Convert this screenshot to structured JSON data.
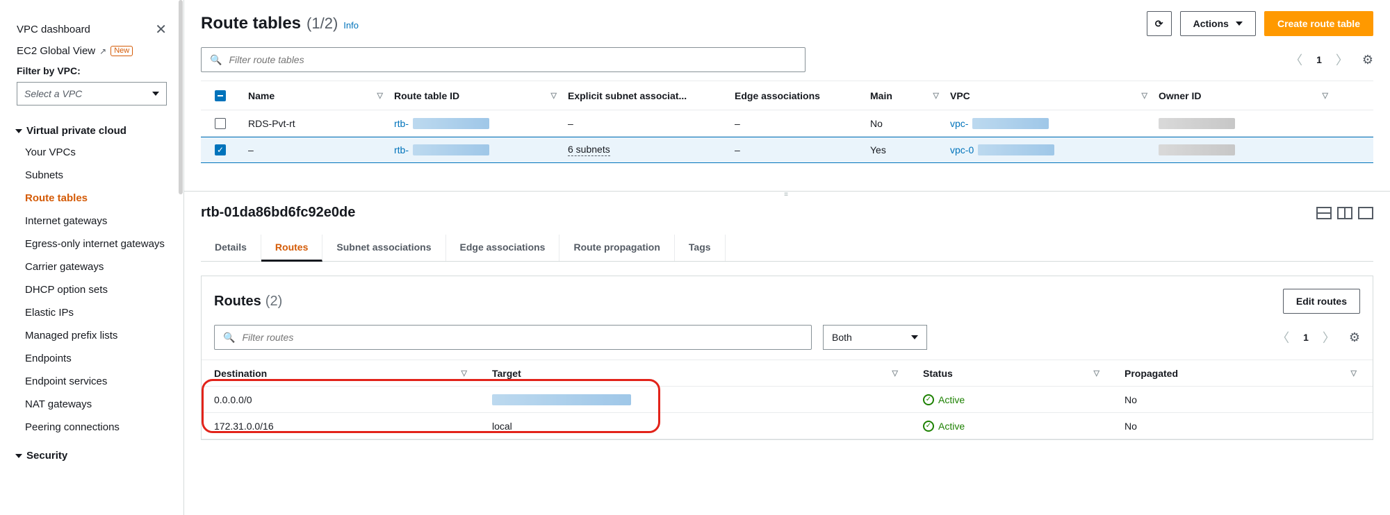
{
  "sidebar": {
    "dashboard": "VPC dashboard",
    "globalview": "EC2 Global View",
    "new_badge": "New",
    "filter_label": "Filter by VPC:",
    "select_placeholder": "Select a VPC",
    "section_vpc": "Virtual private cloud",
    "items": [
      "Your VPCs",
      "Subnets",
      "Route tables",
      "Internet gateways",
      "Egress-only internet gateways",
      "Carrier gateways",
      "DHCP option sets",
      "Elastic IPs",
      "Managed prefix lists",
      "Endpoints",
      "Endpoint services",
      "NAT gateways",
      "Peering connections"
    ],
    "section_security": "Security"
  },
  "header": {
    "title": "Route tables",
    "count": "(1/2)",
    "info": "Info",
    "actions": "Actions",
    "create": "Create route table"
  },
  "search": {
    "placeholder": "Filter route tables"
  },
  "pager": {
    "page": "1"
  },
  "columns": [
    "Name",
    "Route table ID",
    "Explicit subnet associat...",
    "Edge associations",
    "Main",
    "VPC",
    "Owner ID"
  ],
  "rows": [
    {
      "name": "RDS-Pvt-rt",
      "rtid_prefix": "rtb-",
      "subnets": "–",
      "edge": "–",
      "main": "No",
      "vpc_prefix": "vpc-",
      "selected": false
    },
    {
      "name": "–",
      "rtid_prefix": "rtb-",
      "subnets": "6 subnets",
      "edge": "–",
      "main": "Yes",
      "vpc_prefix": "vpc-0",
      "selected": true
    }
  ],
  "detail": {
    "id": "rtb-01da86bd6fc92e0de",
    "tabs": [
      "Details",
      "Routes",
      "Subnet associations",
      "Edge associations",
      "Route propagation",
      "Tags"
    ],
    "active_tab": "Routes",
    "routes_title": "Routes",
    "routes_count": "(2)",
    "edit_routes": "Edit routes",
    "routes_search_placeholder": "Filter routes",
    "filter_dropdown": "Both",
    "routes_columns": [
      "Destination",
      "Target",
      "Status",
      "Propagated"
    ],
    "routes_rows": [
      {
        "dest": "0.0.0.0/0",
        "target_blur": true,
        "target_text": "",
        "status": "Active",
        "propagated": "No"
      },
      {
        "dest": "172.31.0.0/16",
        "target_blur": false,
        "target_text": "local",
        "status": "Active",
        "propagated": "No"
      }
    ],
    "routes_page": "1"
  }
}
